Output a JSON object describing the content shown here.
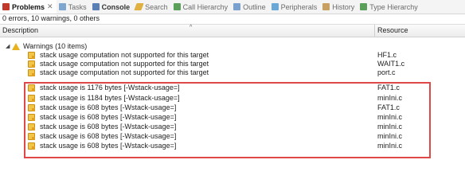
{
  "tabs": [
    {
      "label": "Problems",
      "icon": "problems-icon",
      "color": "#c0392b",
      "active": true
    },
    {
      "label": "Tasks",
      "icon": "tasks-icon",
      "color": "#7fa6cf",
      "active": false
    },
    {
      "label": "Console",
      "icon": "console-icon",
      "color": "#5a7fb5",
      "active": false
    },
    {
      "label": "Search",
      "icon": "search-icon",
      "color": "#e0b040",
      "active": false
    },
    {
      "label": "Call Hierarchy",
      "icon": "call-hierarchy-icon",
      "color": "#5aa05a",
      "active": false
    },
    {
      "label": "Outline",
      "icon": "outline-icon",
      "color": "#7aa0d0",
      "active": false
    },
    {
      "label": "Peripherals",
      "icon": "peripherals-icon",
      "color": "#6aa8d8",
      "active": false
    },
    {
      "label": "History",
      "icon": "history-icon",
      "color": "#c8a060",
      "active": false
    },
    {
      "label": "Type Hierarchy",
      "icon": "type-hierarchy-icon",
      "color": "#5aa05a",
      "active": false
    }
  ],
  "close_glyph": "✕",
  "summary": "0 errors, 10 warnings, 0 others",
  "columns": {
    "description": "Description",
    "resource": "Resource"
  },
  "group": {
    "label": "Warnings (10 items)"
  },
  "rows": [
    {
      "description": "stack usage computation not supported for this target",
      "resource": "HF1.c"
    },
    {
      "description": "stack usage computation not supported for this target",
      "resource": "WAIT1.c"
    },
    {
      "description": "stack usage computation not supported for this target",
      "resource": "port.c"
    },
    {
      "description": "stack usage is 1176 bytes [-Wstack-usage=]",
      "resource": "FAT1.c"
    },
    {
      "description": "stack usage is 1184 bytes [-Wstack-usage=]",
      "resource": "minIni.c"
    },
    {
      "description": "stack usage is 608 bytes [-Wstack-usage=]",
      "resource": "FAT1.c"
    },
    {
      "description": "stack usage is 608 bytes [-Wstack-usage=]",
      "resource": "minIni.c"
    },
    {
      "description": "stack usage is 608 bytes [-Wstack-usage=]",
      "resource": "minIni.c"
    },
    {
      "description": "stack usage is 608 bytes [-Wstack-usage=]",
      "resource": "minIni.c"
    },
    {
      "description": "stack usage is 608 bytes [-Wstack-usage=]",
      "resource": "minIni.c"
    }
  ],
  "colors": {
    "highlight": "#e04848",
    "warning": "#f2c447"
  }
}
